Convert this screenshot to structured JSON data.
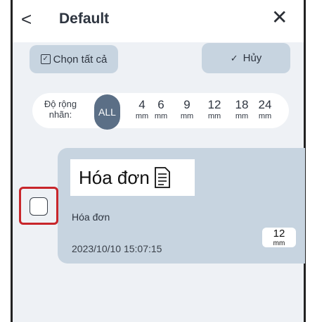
{
  "header": {
    "back_icon": "chevron-left-icon",
    "title": "Default",
    "close_icon": "close-icon"
  },
  "toolbar": {
    "select_all_label": "Chọn tất cả",
    "cancel_label": "Hủy"
  },
  "width_filter": {
    "label_line1": "Độ rộng",
    "label_line2": "nhãn:",
    "all_label": "ALL",
    "options": [
      {
        "num": "4",
        "unit": "mm"
      },
      {
        "num": "6",
        "unit": "mm"
      },
      {
        "num": "9",
        "unit": "mm"
      },
      {
        "num": "12",
        "unit": "mm"
      },
      {
        "num": "18",
        "unit": "mm"
      },
      {
        "num": "24",
        "unit": "mm"
      }
    ]
  },
  "items": [
    {
      "preview_text": "Hóa đơn",
      "name": "Hóa đơn",
      "date": "2023/10/10 15:07:15",
      "size_num": "12",
      "size_unit": "mm",
      "checked": false
    }
  ],
  "colors": {
    "accent": "#5b6f86",
    "button_bg": "#c7d4e0",
    "panel_bg": "#eef1f5",
    "highlight": "#c8262b"
  }
}
